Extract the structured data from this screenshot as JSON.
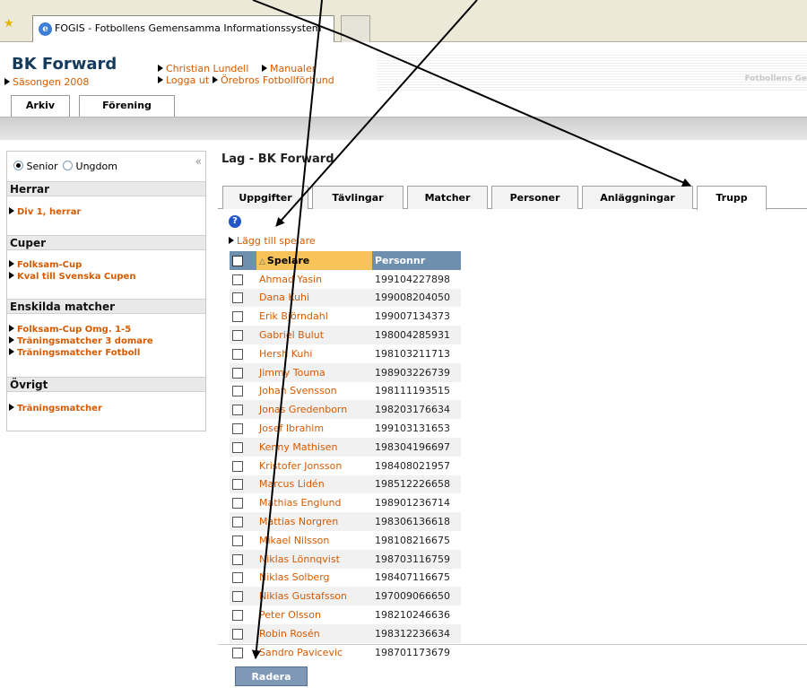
{
  "browser": {
    "tab_title": "FOGIS - Fotbollens Gemensamma Informationssystem"
  },
  "header": {
    "club_name": "BK Forward",
    "season": "Säsongen 2008",
    "links": {
      "user": "Christian Lundell",
      "manuals": "Manualer",
      "logout": "Logga ut",
      "district": "Örebros Fotbollförbund"
    },
    "brand_text": "Fotbollens Ge",
    "main_tabs": [
      "Arkiv",
      "Förening"
    ]
  },
  "sidebar": {
    "radio_senior": "Senior",
    "radio_ungdom": "Ungdom",
    "collapse_glyph": "«",
    "sections": [
      {
        "title": "Herrar",
        "items": [
          "Div 1, herrar"
        ]
      },
      {
        "title": "Cuper",
        "items": [
          "Folksam-Cup",
          "Kval till Svenska Cupen"
        ]
      },
      {
        "title": "Enskilda matcher",
        "items": [
          "Folksam-Cup Omg. 1-5",
          "Träningsmatcher 3 domare",
          "Träningsmatcher Fotboll"
        ]
      },
      {
        "title": "Övrigt",
        "items": [
          "Träningsmatcher"
        ]
      }
    ]
  },
  "content": {
    "title": "Lag - BK Forward",
    "tabs": [
      "Uppgifter",
      "Tävlingar",
      "Matcher",
      "Personer",
      "Anläggningar",
      "Trupp"
    ],
    "active_tab": "Trupp",
    "help_glyph": "?",
    "add_player": "Lägg till spelare",
    "table": {
      "headers": {
        "name": "Spelare",
        "personnr": "Personnr"
      },
      "rows": [
        {
          "name": "Ahmad Yasin",
          "personnr": "199104227898"
        },
        {
          "name": "Dana Kuhi",
          "personnr": "199008204050"
        },
        {
          "name": "Erik Björndahl",
          "personnr": "199007134373"
        },
        {
          "name": "Gabriel Bulut",
          "personnr": "198004285931"
        },
        {
          "name": "Hersh Kuhi",
          "personnr": "198103211713"
        },
        {
          "name": "Jimmy Touma",
          "personnr": "198903226739"
        },
        {
          "name": "Johan Svensson",
          "personnr": "198111193515"
        },
        {
          "name": "Jonas Gredenborn",
          "personnr": "198203176634"
        },
        {
          "name": "Josef Ibrahim",
          "personnr": "199103131653"
        },
        {
          "name": "Kenny Mathisen",
          "personnr": "198304196697"
        },
        {
          "name": "Kristofer Jonsson",
          "personnr": "198408021957"
        },
        {
          "name": "Marcus Lidén",
          "personnr": "198512226658"
        },
        {
          "name": "Mathias Englund",
          "personnr": "198901236714"
        },
        {
          "name": "Mattias Norgren",
          "personnr": "198306136618"
        },
        {
          "name": "Mikael Nilsson",
          "personnr": "198108216675"
        },
        {
          "name": "Niklas Lönnqvist",
          "personnr": "198703116759"
        },
        {
          "name": "Niklas Solberg",
          "personnr": "198407116675"
        },
        {
          "name": "Niklas Gustafsson",
          "personnr": "197009066650"
        },
        {
          "name": "Peter Olsson",
          "personnr": "198210246636"
        },
        {
          "name": "Robin Rosén",
          "personnr": "198312236634"
        },
        {
          "name": "Sandro Pavicevic",
          "personnr": "198701173679"
        }
      ]
    },
    "delete_button": "Radera"
  },
  "colors": {
    "link_orange": "#d65a00",
    "header_blue": "#6f8faf",
    "sorted_header": "#f8c35a"
  },
  "icons": [
    "favorites-star-icon",
    "ie-icon",
    "help-icon",
    "sort-asc-icon",
    "arrow-bullet-icon"
  ]
}
